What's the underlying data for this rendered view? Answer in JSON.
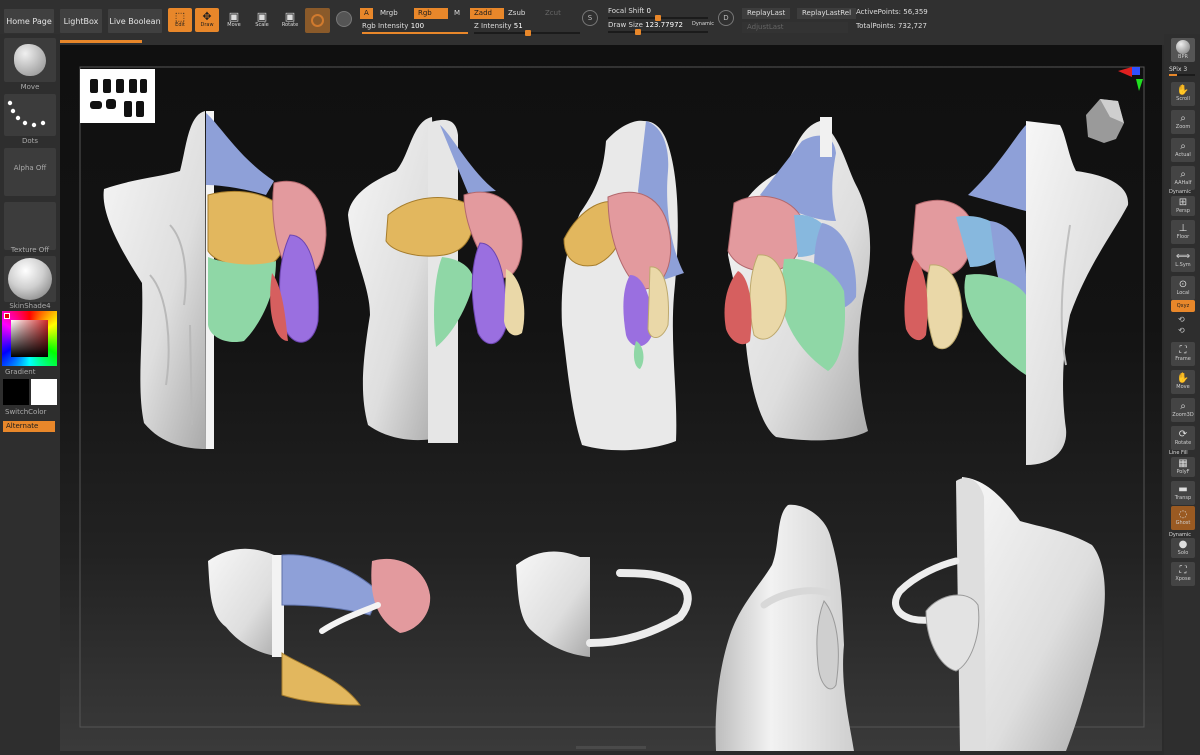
{
  "top_tabs": [
    "Home Page",
    "LightBox",
    "Live Boolean"
  ],
  "tools": [
    {
      "name": "edit",
      "label": "Edit",
      "icon": "edit-icon",
      "active": true
    },
    {
      "name": "draw",
      "label": "Draw",
      "icon": "draw-icon",
      "active": true
    },
    {
      "name": "move",
      "label": "Move",
      "icon": "move-icon",
      "active": false
    },
    {
      "name": "scale",
      "label": "Scale",
      "icon": "scale-icon",
      "active": false
    },
    {
      "name": "rotate",
      "label": "Rotate",
      "icon": "rotate-icon",
      "active": false
    }
  ],
  "mode_chips": {
    "a": "A",
    "mrgb": "Mrgb",
    "rgb": "Rgb",
    "m": "M",
    "zadd": "Zadd",
    "zsub": "Zsub",
    "zcut": "Zcut"
  },
  "sliders": {
    "rgb_intensity": {
      "label": "Rgb Intensity",
      "value": "100",
      "level": 1.0
    },
    "z_intensity": {
      "label": "Z Intensity",
      "value": "51",
      "level": 0.51
    },
    "focal_shift": {
      "label": "Focal Shift",
      "value": "0",
      "level": 0.5
    },
    "draw_size": {
      "label": "Draw Size",
      "value": "123.77972",
      "level": 0.3
    }
  },
  "dynamic_label": "Dynamic",
  "replay": {
    "replay_last": "ReplayLast",
    "replay_last_rel": "ReplayLastRel",
    "adjust_last": "AdjustLast"
  },
  "points": {
    "active": "ActivePoints: 56,359",
    "total": "TotalPoints: 732,727"
  },
  "left_shelf": {
    "brush": "Move",
    "stroke": "Dots",
    "alpha": "Alpha Off",
    "texture": "Texture Off",
    "material": "SkinShade4",
    "gradient": "Gradient",
    "switch_color": "SwitchColor",
    "alternate": "Alternate"
  },
  "right_shelf": {
    "items": [
      "BPR",
      "SPix 3",
      "Scroll",
      "Zoom",
      "Actual",
      "AAHalf",
      "Dynamic",
      "Persp",
      "Floor",
      "L.Sym",
      "Local",
      "Qxyz",
      "Frame",
      "Move",
      "Zoom3D",
      "Rotate",
      "Line Fill",
      "PolyF",
      "Transp",
      "Ghost",
      "Dynamic",
      "Solo",
      "Xpose"
    ]
  },
  "reference_image_label": "reference thumbnail",
  "colors": {
    "accent": "#e8872a",
    "trap": "#8ea0d8",
    "deltoid": "#e39a9e",
    "pectoral": "#e2b75e",
    "biceps": "#9a6fe0",
    "lat": "#8fd7a6",
    "teres": "#87b8de",
    "triceps": "#ead8a8"
  }
}
